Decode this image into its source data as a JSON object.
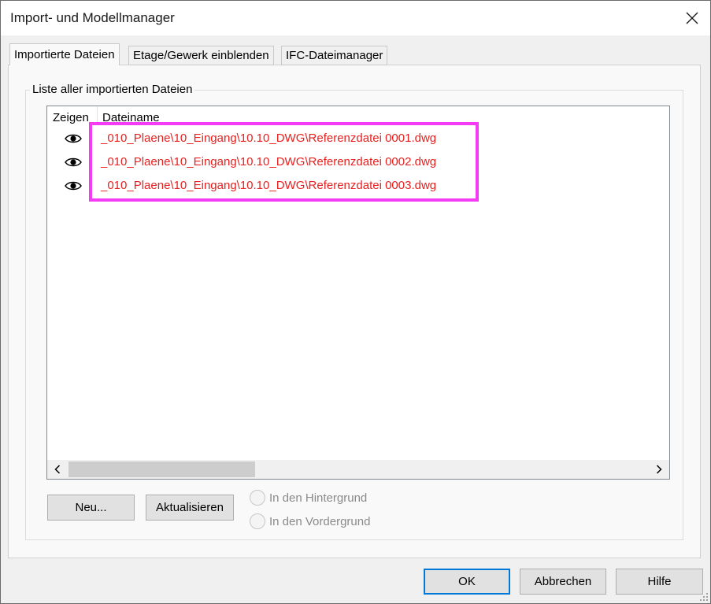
{
  "window": {
    "title": "Import- und Modellmanager"
  },
  "tabs": [
    {
      "label": "Importierte Dateien",
      "active": true
    },
    {
      "label": "Etage/Gewerk einblenden",
      "active": false
    },
    {
      "label": "IFC-Dateimanager",
      "active": false
    }
  ],
  "group": {
    "label": "Liste aller importierten Dateien"
  },
  "list": {
    "columns": [
      "Zeigen",
      "Dateiname"
    ],
    "rows": [
      {
        "icon": "eye-icon",
        "filename": "_010_Plaene\\10_Eingang\\10.10_DWG\\Referenzdatei 0001.dwg"
      },
      {
        "icon": "eye-icon",
        "filename": "_010_Plaene\\10_Eingang\\10.10_DWG\\Referenzdatei 0002.dwg"
      },
      {
        "icon": "eye-icon",
        "filename": "_010_Plaene\\10_Eingang\\10.10_DWG\\Referenzdatei 0003.dwg"
      }
    ],
    "filename_color": "#e8201f",
    "highlight_color": "#f33cf3"
  },
  "actions": {
    "new_label": "Neu...",
    "refresh_label": "Aktualisieren",
    "radio_background": "In den Hintergrund",
    "radio_foreground": "In den Vordergrund"
  },
  "footer": {
    "ok_label": "OK",
    "cancel_label": "Abbrechen",
    "help_label": "Hilfe"
  },
  "colors": {
    "accent": "#0078d7"
  }
}
